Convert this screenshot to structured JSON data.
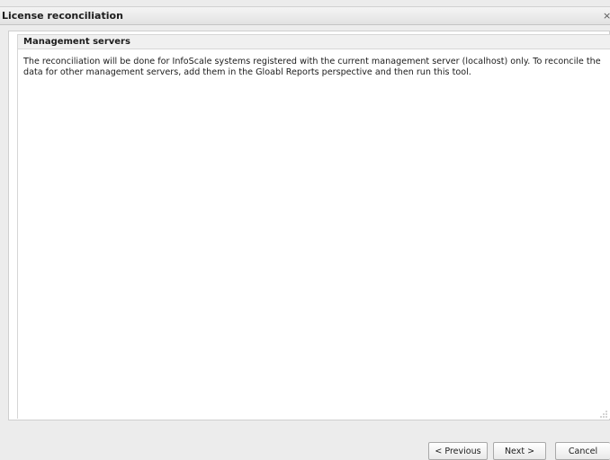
{
  "window": {
    "title": "License reconciliation",
    "close_glyph": "×"
  },
  "panel": {
    "section_title": "Management servers",
    "message": "The reconciliation will be done for InfoScale systems registered with the current management server (localhost) only. To reconcile the data for other management servers, add them in the Gloabl Reports perspective and then run this tool."
  },
  "footer": {
    "previous_label": "< Previous",
    "next_label": "Next >",
    "cancel_label": "Cancel"
  }
}
